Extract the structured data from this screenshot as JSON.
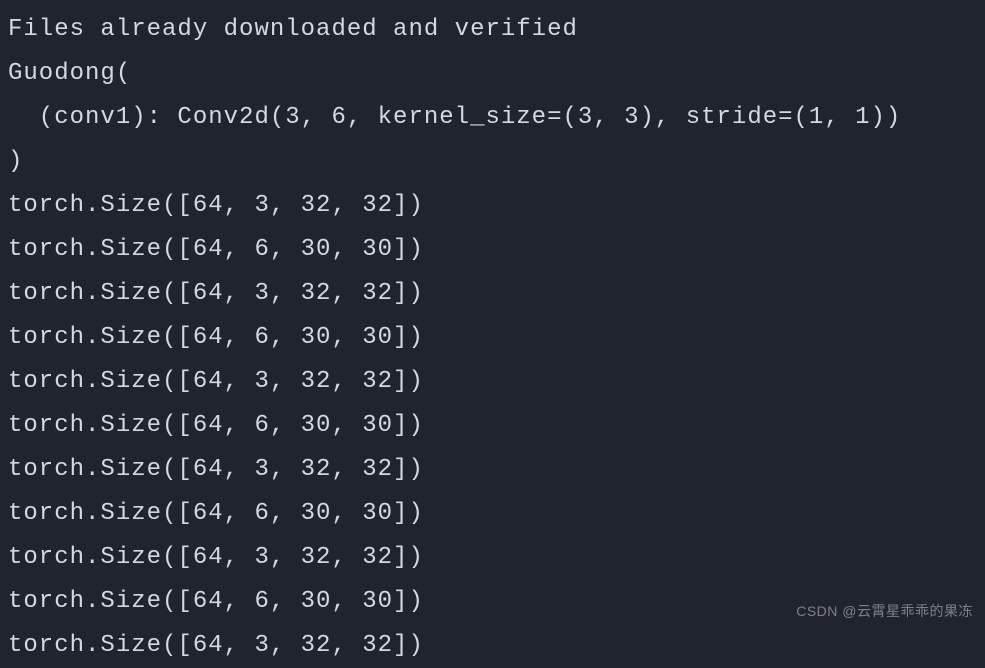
{
  "terminal": {
    "lines": [
      "Files already downloaded and verified",
      "Guodong(",
      "  (conv1): Conv2d(3, 6, kernel_size=(3, 3), stride=(1, 1))",
      ")",
      "torch.Size([64, 3, 32, 32])",
      "torch.Size([64, 6, 30, 30])",
      "torch.Size([64, 3, 32, 32])",
      "torch.Size([64, 6, 30, 30])",
      "torch.Size([64, 3, 32, 32])",
      "torch.Size([64, 6, 30, 30])",
      "torch.Size([64, 3, 32, 32])",
      "torch.Size([64, 6, 30, 30])",
      "torch.Size([64, 3, 32, 32])",
      "torch.Size([64, 6, 30, 30])",
      "torch.Size([64, 3, 32, 32])"
    ]
  },
  "watermark": {
    "text": "CSDN @云霄星乖乖的果冻"
  }
}
